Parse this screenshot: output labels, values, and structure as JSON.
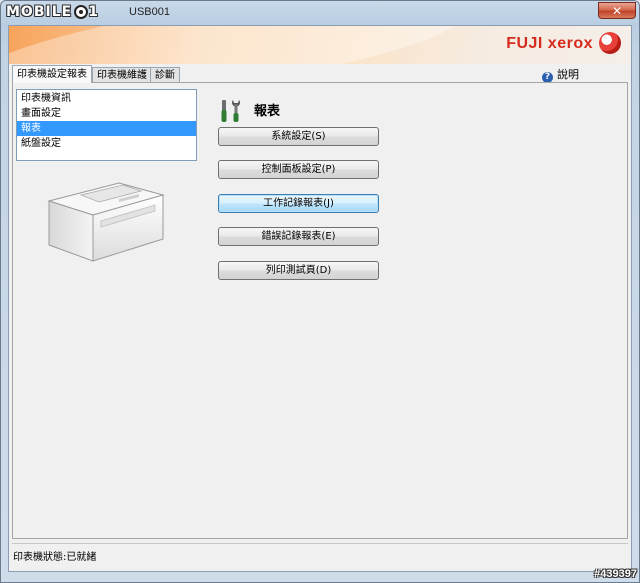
{
  "window": {
    "watermark_logo": "MOBILE01",
    "title": "USB001",
    "close_label": "✕"
  },
  "header": {
    "brand": "FUJI xerox",
    "help_label": "說明"
  },
  "tabs": [
    {
      "label": "印表機設定報表",
      "active": true
    },
    {
      "label": "印表機維護",
      "active": false
    },
    {
      "label": "診斷",
      "active": false
    }
  ],
  "menu": {
    "items": [
      {
        "label": "印表機資訊",
        "selected": false
      },
      {
        "label": "畫面設定",
        "selected": false
      },
      {
        "label": "報表",
        "selected": true
      },
      {
        "label": "紙盤設定",
        "selected": false
      }
    ]
  },
  "section": {
    "icon": "tools-icon",
    "title": "報表"
  },
  "buttons": [
    {
      "label": "系統設定(S)",
      "focused": false
    },
    {
      "label": "控制面板設定(P)",
      "focused": false
    },
    {
      "label": "工作記錄報表(J)",
      "focused": true
    },
    {
      "label": "錯誤記錄報表(E)",
      "focused": false
    },
    {
      "label": "列印測試頁(D)",
      "focused": false
    }
  ],
  "status": {
    "text": "印表機狀態:已就緒"
  },
  "footer": {
    "watermark_id": "#439397"
  },
  "colors": {
    "brand_red": "#d52b1e",
    "selection_blue": "#3399ff"
  }
}
